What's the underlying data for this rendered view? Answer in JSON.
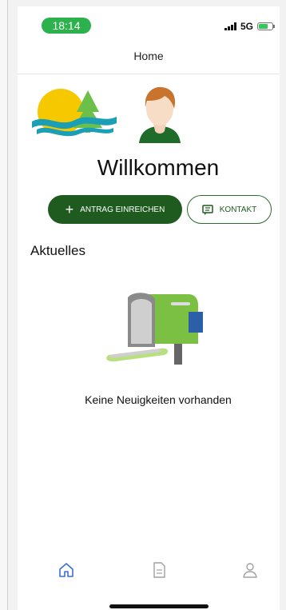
{
  "status_bar": {
    "time": "18:14",
    "network": "5G"
  },
  "nav": {
    "title": "Home"
  },
  "welcome": "Willkommen",
  "actions": {
    "primary_label": "ANTRAG EINREICHEN",
    "secondary_label": "KONTAKT"
  },
  "news": {
    "title": "Aktuelles",
    "empty_message": "Keine Neuigkeiten vorhanden"
  },
  "tabs": [
    {
      "icon": "home-icon",
      "active": true
    },
    {
      "icon": "document-icon",
      "active": false
    },
    {
      "icon": "profile-icon",
      "active": false
    }
  ],
  "colors": {
    "primary": "#1f5a1f",
    "time_pill": "#2bb24c",
    "active_tab": "#3b6fd6",
    "inactive_tab": "#a0a0a0"
  }
}
